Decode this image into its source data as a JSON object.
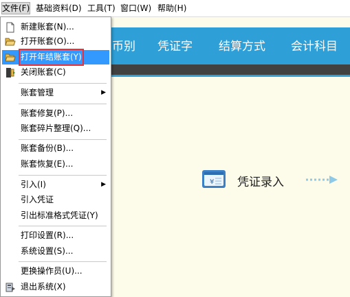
{
  "menubar": {
    "file": "文件(F)",
    "basic_data": "基础资料(D)",
    "tools": "工具(T)",
    "window": "窗口(W)",
    "help": "帮助(H)"
  },
  "banner": {
    "tabs": [
      "币别",
      "凭证字",
      "结算方式",
      "会计科目"
    ]
  },
  "workspace": {
    "voucher_entry": "凭证录入"
  },
  "file_menu": {
    "items": [
      {
        "label": "新建账套(N)...",
        "icon": "new-document-icon"
      },
      {
        "label": "打开账套(O)...",
        "icon": "open-folder-icon"
      },
      {
        "label": "打开年结账套(Y)",
        "icon": "open-folder-icon",
        "highlighted": true
      },
      {
        "label": "关闭账套(C)",
        "icon": "close-door-icon"
      },
      {
        "label": "账套管理",
        "submenu": true
      },
      {
        "label": "账套修复(P)..."
      },
      {
        "label": "账套碎片整理(Q)..."
      },
      {
        "label": "账套备份(B)..."
      },
      {
        "label": "账套恢复(E)..."
      },
      {
        "label": "引入(I)",
        "submenu": true
      },
      {
        "label": "引入凭证"
      },
      {
        "label": "引出标准格式凭证(Y)"
      },
      {
        "label": "打印设置(R)..."
      },
      {
        "label": "系统设置(S)..."
      },
      {
        "label": "更换操作员(U)..."
      },
      {
        "label": "退出系统(X)",
        "icon": "exit-icon"
      }
    ]
  },
  "colors": {
    "banner": "#2e9fd7",
    "highlight": "#3399ff",
    "highlight_border": "#e8313a",
    "workspace": "#fdfbe9"
  }
}
